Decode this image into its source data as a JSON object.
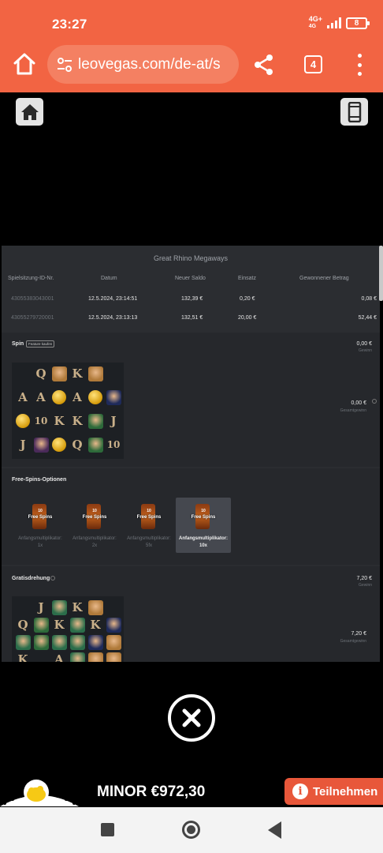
{
  "status_bar": {
    "time": "23:27",
    "network": "4G+",
    "network_sub": "4G",
    "battery": "8"
  },
  "browser": {
    "url": "leovegas.com/de-at/s",
    "tab_count": "4"
  },
  "history": {
    "title": "Great Rhino Megaways",
    "columns": [
      "Spielsitzung-ID-Nr.",
      "Datum",
      "Neuer Saldo",
      "Einsatz",
      "Gewonnener Betrag"
    ],
    "rows": [
      {
        "id": "43055383043001",
        "date": "12.5.2024, 23:14:51",
        "balance": "132,39 €",
        "stake": "0,20 €",
        "win": "0,08 €"
      },
      {
        "id": "43055279720001",
        "date": "12.5.2024, 23:13:13",
        "balance": "132,51 €",
        "stake": "20,00 €",
        "win": "52,44 €"
      }
    ],
    "spin": {
      "label": "Spin",
      "feature_badge": "Feature kaufen",
      "win": "0,00 €",
      "win_label": "Gewinn",
      "total": "0,00 €",
      "total_label": "Gesamtgewinn",
      "grid": [
        [
          "",
          "Q",
          "lion",
          "K",
          "lion",
          ""
        ],
        [
          "A",
          "A",
          "coin",
          "A",
          "coin",
          "rhino"
        ],
        [
          "coin",
          "10",
          "K",
          "K",
          "croc",
          "J"
        ],
        [
          "J",
          "gorilla",
          "coin",
          "Q",
          "croc",
          "10"
        ]
      ]
    },
    "free_spins_options": {
      "label": "Free-Spins-Optionen",
      "options": [
        {
          "count": "10",
          "text": "Free Spins",
          "multiplier_label": "Anfangsmultiplikator:",
          "multiplier": "1x",
          "selected": false
        },
        {
          "count": "10",
          "text": "Free Spins",
          "multiplier_label": "Anfangsmultiplikator:",
          "multiplier": "2x",
          "selected": false
        },
        {
          "count": "10",
          "text": "Free Spins",
          "multiplier_label": "Anfangsmultiplikator:",
          "multiplier": "5fx",
          "selected": false
        },
        {
          "count": "10",
          "text": "Free Spins",
          "multiplier_label": "Anfangsmultiplikator:",
          "multiplier": "10x",
          "selected": true
        }
      ]
    },
    "free_spin": {
      "label": "Gratisdrehung",
      "win": "7,20 €",
      "win_label": "Gewinn",
      "total": "7,20 €",
      "total_label": "Gesamtgewinn",
      "grid": [
        [
          "",
          "J",
          "flamingo",
          "K",
          "lion",
          ""
        ],
        [
          "Q",
          "croc",
          "K",
          "flamingo",
          "K",
          "rhino"
        ],
        [
          "flamingo",
          "croc",
          "flamingo",
          "flamingo",
          "rhino",
          "lion"
        ],
        [
          "K",
          "",
          "A",
          "flamingo",
          "lion",
          "lion"
        ]
      ]
    }
  },
  "jackpot": {
    "text": "MINOR €972,30",
    "join_label": "Teilnehmen",
    "join_icon": "info-icon"
  },
  "colors": {
    "brand": "#f26443",
    "panel": "#2b2d31",
    "join": "#e8573a"
  }
}
